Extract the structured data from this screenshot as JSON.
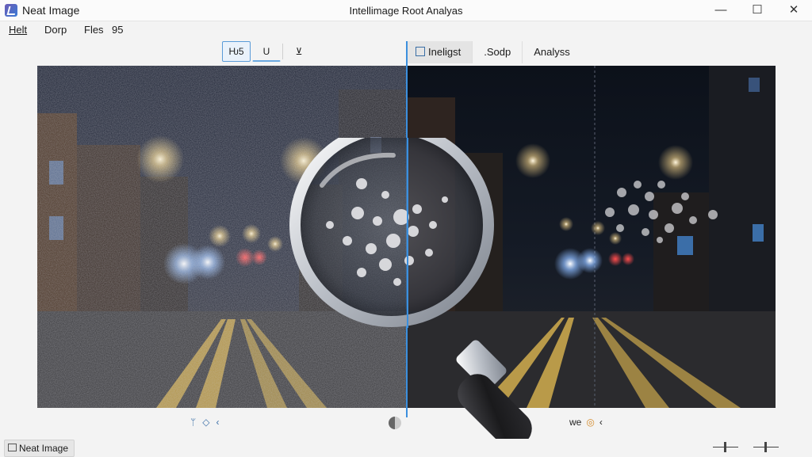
{
  "app": {
    "name": "Neat Image",
    "window_title": "Intellimage Root Analyas"
  },
  "window_controls": {
    "minimize": "—",
    "maximize": "☐",
    "close": "✕"
  },
  "menu": [
    "Helt",
    "Dorp",
    "Fles",
    "95"
  ],
  "toolbar": {
    "buttons": [
      "Ƕ5",
      "U",
      "⊻"
    ]
  },
  "tabs": [
    "Ineligst",
    ".Sodp",
    "Analyss"
  ],
  "footer": {
    "left_icons": [
      "ᛘ",
      "◇",
      "‹"
    ],
    "right_text": "we",
    "right_icons": [
      "◎",
      "‹"
    ]
  },
  "status": {
    "label": "Neat Image"
  },
  "colors": {
    "accent": "#3b8fde",
    "titlebar": "#fbfbfb",
    "background": "#f3f3f3"
  },
  "icons": {
    "app": "neat-image-logo-icon",
    "magnifier": "magnifying-glass-icon",
    "split": "split-handle-icon"
  }
}
